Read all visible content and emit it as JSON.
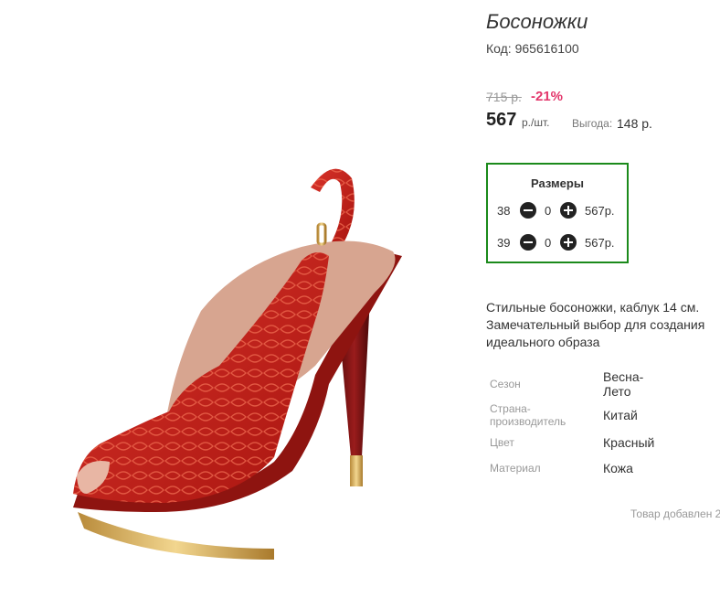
{
  "product": {
    "title": "Босоножки",
    "code": "Код: 965616100",
    "old_price": "715 р.",
    "discount": "-21%",
    "price": "567",
    "unit": "р./шт.",
    "saving_label": "Выгода:",
    "saving_value": "148 р.",
    "image_alt": "red sandal photo",
    "accent_color": "#e3366b",
    "sizes_border_color": "#1b8a1b"
  },
  "sizes": {
    "title": "Размеры",
    "rows": [
      {
        "size": "38",
        "qty": "0",
        "price": "567р."
      },
      {
        "size": "39",
        "qty": "0",
        "price": "567р."
      }
    ]
  },
  "description": "Стильные босоножки, каблук 14 см. Замечательный выбор для создания идеального образа",
  "attributes": [
    {
      "label": "Сезон",
      "value": "Весна-Лето"
    },
    {
      "label": "Страна-производитель",
      "value": "Китай"
    },
    {
      "label": "Цвет",
      "value": "Красный"
    },
    {
      "label": "Материал",
      "value": "Кожа"
    }
  ],
  "footer": {
    "added": "Товар добавлен 2"
  },
  "icons": {
    "minus": "minus-circle-icon",
    "plus": "plus-circle-icon"
  }
}
